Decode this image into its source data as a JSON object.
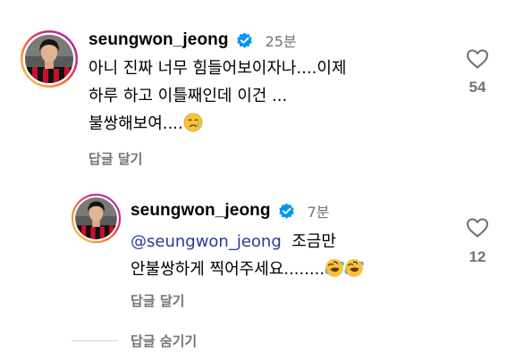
{
  "comment": {
    "username": "seungwon_jeong",
    "verified_icon": "verified-badge-icon",
    "time": "25분",
    "lines": [
      "아니 진짜 너무 힘들어보이자나....이제",
      "하루 하고 이틀째인데 이건 ...",
      "불쌍해보여...."
    ],
    "emoji": "crying-face-icon",
    "reply_label": "답글 달기",
    "likes": "54"
  },
  "reply": {
    "username": "seungwon_jeong",
    "time": "7분",
    "mention": "@seungwon_jeong",
    "line1_text": "조금만",
    "line2_text": "안불쌍하게 찍어주세요........",
    "emoji": "rolling-on-floor-laughing-icon",
    "reply_label": "답글 달기",
    "likes": "12"
  },
  "hide_replies_label": "답글 숨기기",
  "colors": {
    "secondary_text": "#737373",
    "verified_blue": "#0095f6",
    "mention_blue": "#263c9a",
    "story_ring": [
      "#feda75",
      "#fa7e1e",
      "#d62976",
      "#962fbf"
    ]
  }
}
